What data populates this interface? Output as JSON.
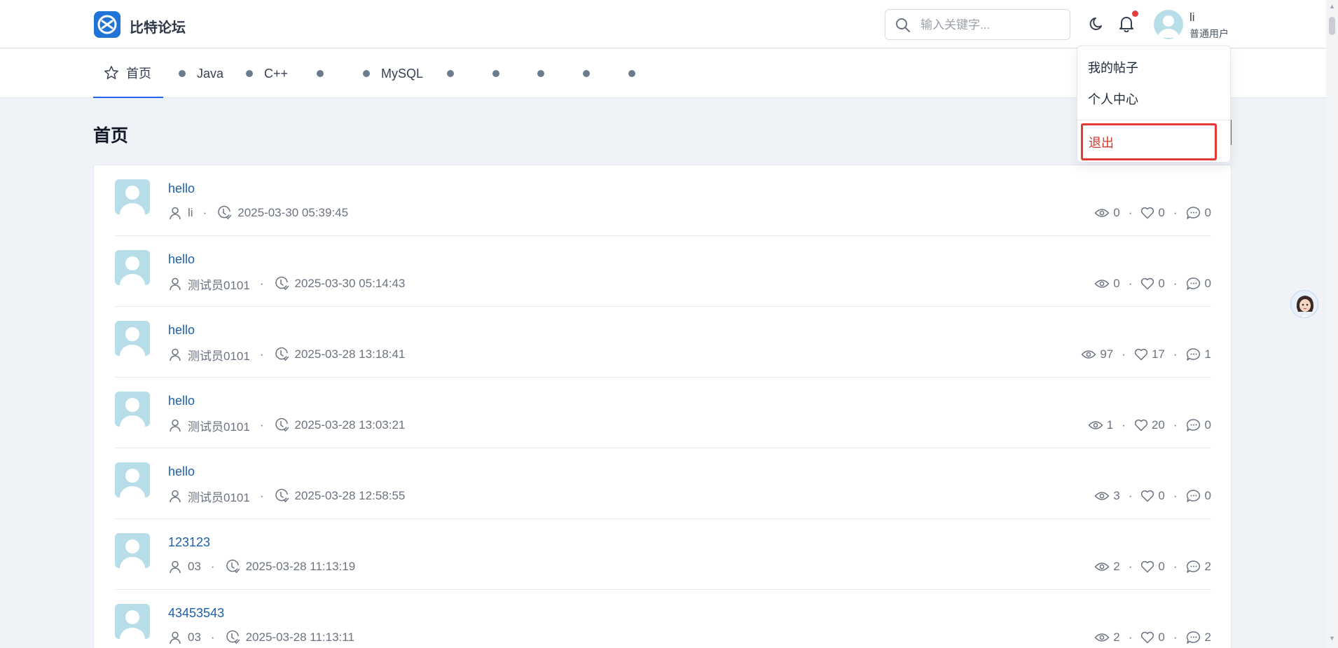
{
  "header": {
    "brand": "比特论坛",
    "search_placeholder": "输入关键字...",
    "user": {
      "name": "li",
      "role": "普通用户"
    }
  },
  "nav": {
    "items": [
      {
        "label": "首页",
        "active": true
      },
      {
        "label": "Java"
      },
      {
        "label": "C++"
      },
      {
        "label": ""
      },
      {
        "label": "MySQL"
      },
      {
        "label": ""
      },
      {
        "label": ""
      },
      {
        "label": ""
      },
      {
        "label": ""
      },
      {
        "label": ""
      }
    ]
  },
  "page": {
    "title": "首页"
  },
  "dropdown": {
    "items": [
      "我的帖子",
      "个人中心"
    ],
    "logout": "退出"
  },
  "posts": [
    {
      "title": "hello",
      "author": "li",
      "time": "2025-03-30 05:39:45",
      "views": "0",
      "likes": "0",
      "comments": "0"
    },
    {
      "title": "hello",
      "author": "测试员0101",
      "time": "2025-03-30 05:14:43",
      "views": "0",
      "likes": "0",
      "comments": "0"
    },
    {
      "title": "hello",
      "author": "测试员0101",
      "time": "2025-03-28 13:18:41",
      "views": "97",
      "likes": "17",
      "comments": "1"
    },
    {
      "title": "hello",
      "author": "测试员0101",
      "time": "2025-03-28 13:03:21",
      "views": "1",
      "likes": "20",
      "comments": "0"
    },
    {
      "title": "hello",
      "author": "测试员0101",
      "time": "2025-03-28 12:58:55",
      "views": "3",
      "likes": "0",
      "comments": "0"
    },
    {
      "title": "123123",
      "author": "03",
      "time": "2025-03-28 11:13:19",
      "views": "2",
      "likes": "0",
      "comments": "2"
    },
    {
      "title": "43453543",
      "author": "03",
      "time": "2025-03-28 11:13:11",
      "views": "2",
      "likes": "0",
      "comments": "2"
    }
  ],
  "colors": {
    "accent": "#2563eb",
    "link": "#1d5fae",
    "danger": "#e53935",
    "background": "#eff3f8"
  },
  "icons": {
    "search": "search-icon",
    "moon": "moon-icon",
    "bell": "bell-icon",
    "star": "star-icon",
    "user": "user-icon",
    "clock": "clock-icon",
    "eye": "eye-icon",
    "heart": "heart-icon",
    "comment": "comment-icon"
  }
}
